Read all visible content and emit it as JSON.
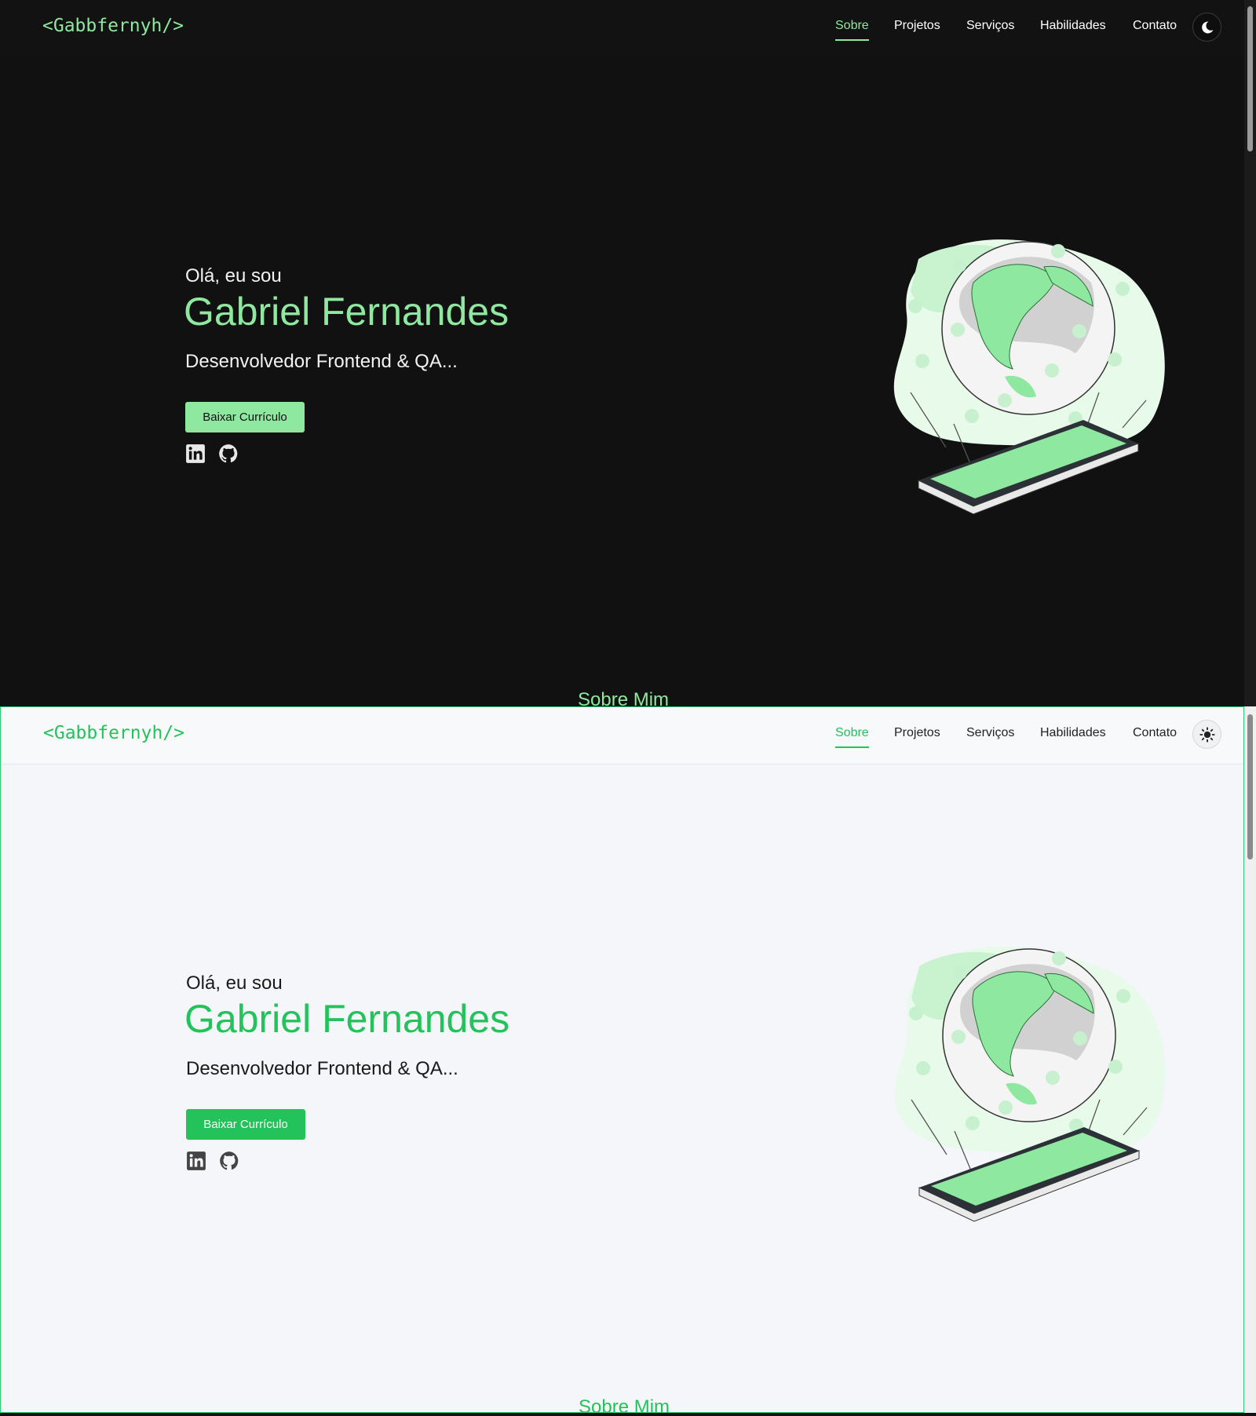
{
  "brand": {
    "logo": "<Gabbfernyh/>"
  },
  "nav": {
    "items": [
      "Sobre",
      "Projetos",
      "Serviços",
      "Habilidades",
      "Contato"
    ],
    "active": "Sobre"
  },
  "hero": {
    "greeting": "Olá, eu sou",
    "name": "Gabriel Fernandes",
    "role": "Desenvolvedor Frontend & QA...",
    "cta_label": "Baixar Currículo"
  },
  "social": {
    "icons": [
      "linkedin-icon",
      "github-icon"
    ]
  },
  "next_section": {
    "title": "Sobre Mim"
  },
  "themes": {
    "dark": {
      "toggle_icon": "moon-icon",
      "accent": "#8ee89f",
      "background": "#111112"
    },
    "light": {
      "toggle_icon": "sun-icon",
      "accent": "#23c25a",
      "background": "#f4f6fa"
    }
  }
}
